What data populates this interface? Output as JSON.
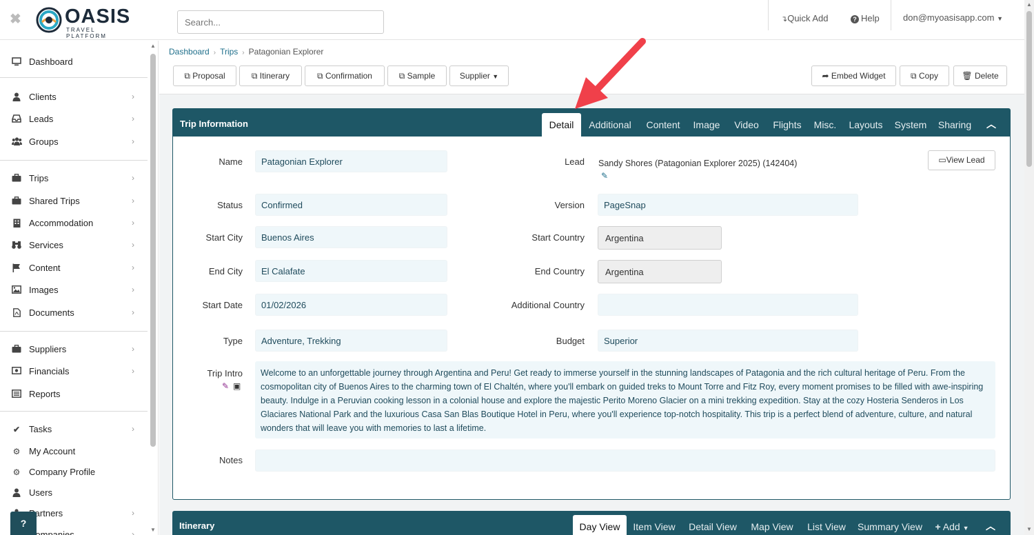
{
  "topbar": {
    "close_glyph": "✖",
    "logo_text": "OASIS",
    "logo_sub": "TRAVEL PLATFORM",
    "search_placeholder": "Search...",
    "quick_add": "Quick Add",
    "help": "Help",
    "user": "don@myoasisapp.com"
  },
  "sidebar": {
    "items": [
      {
        "label": "Dashboard",
        "icon": "monitor-icon",
        "glyph": "🖵",
        "chevron": false
      },
      {
        "label": "Clients",
        "icon": "user-icon",
        "glyph": "●",
        "chevron": true
      },
      {
        "label": "Leads",
        "icon": "inbox-icon",
        "glyph": "▭",
        "chevron": true
      },
      {
        "label": "Groups",
        "icon": "users-icon",
        "glyph": "●",
        "chevron": true
      },
      {
        "label": "Trips",
        "icon": "briefcase-icon",
        "glyph": "▆",
        "chevron": true
      },
      {
        "label": "Shared Trips",
        "icon": "briefcase-icon",
        "glyph": "▆",
        "chevron": true
      },
      {
        "label": "Accommodation",
        "icon": "building-icon",
        "glyph": "▮",
        "chevron": true
      },
      {
        "label": "Services",
        "icon": "binoculars-icon",
        "glyph": "▞",
        "chevron": true
      },
      {
        "label": "Content",
        "icon": "flag-icon",
        "glyph": "⚑",
        "chevron": true
      },
      {
        "label": "Images",
        "icon": "image-icon",
        "glyph": "▨",
        "chevron": true
      },
      {
        "label": "Documents",
        "icon": "file-pdf-icon",
        "glyph": "▯",
        "chevron": true
      },
      {
        "label": "Suppliers",
        "icon": "briefcase-icon",
        "glyph": "▆",
        "chevron": true
      },
      {
        "label": "Financials",
        "icon": "money-icon",
        "glyph": "▣",
        "chevron": true
      },
      {
        "label": "Reports",
        "icon": "list-alt-icon",
        "glyph": "▤",
        "chevron": false
      },
      {
        "label": "Tasks",
        "icon": "check-icon",
        "glyph": "✔",
        "chevron": true
      },
      {
        "label": "My Account",
        "icon": "gear-icon",
        "glyph": "⚙",
        "chevron": false
      },
      {
        "label": "Company Profile",
        "icon": "gears-icon",
        "glyph": "⚙",
        "chevron": false
      },
      {
        "label": "Users",
        "icon": "user-icon",
        "glyph": "●",
        "chevron": false
      },
      {
        "label": "Partners",
        "icon": "handshake-icon",
        "glyph": "●",
        "chevron": true
      },
      {
        "label": "Companies",
        "icon": "building-icon",
        "glyph": "▮",
        "chevron": true
      }
    ],
    "help_label": "?"
  },
  "breadcrumb": {
    "items": [
      "Dashboard",
      "Trips",
      "Patagonian Explorer"
    ]
  },
  "toolbar": {
    "proposal": "Proposal",
    "itinerary": "Itinerary",
    "confirmation": "Confirmation",
    "sample": "Sample",
    "supplier": "Supplier",
    "embed_widget": "Embed Widget",
    "copy": "Copy",
    "delete": "Delete"
  },
  "trip_panel": {
    "title": "Trip Information",
    "tabs": [
      "Detail",
      "Additional",
      "Content",
      "Image",
      "Video",
      "Flights",
      "Misc.",
      "Layouts",
      "System",
      "Sharing"
    ],
    "active_tab": "Detail",
    "view_lead": "View Lead",
    "fields": {
      "name_label": "Name",
      "name": "Patagonian Explorer",
      "lead_label": "Lead",
      "lead": "Sandy Shores (Patagonian Explorer 2025) (142404)",
      "status_label": "Status",
      "status": "Confirmed",
      "version_label": "Version",
      "version": "PageSnap",
      "start_city_label": "Start City",
      "start_city": "Buenos Aires",
      "start_country_label": "Start Country",
      "start_country": "Argentina",
      "end_city_label": "End City",
      "end_city": "El Calafate",
      "end_country_label": "End Country",
      "end_country": "Argentina",
      "start_date_label": "Start Date",
      "start_date": "01/02/2026",
      "additional_country_label": "Additional Country",
      "additional_country": "",
      "type_label": "Type",
      "type": "Adventure, Trekking",
      "budget_label": "Budget",
      "budget": "Superior",
      "trip_intro_label": "Trip Intro",
      "trip_intro": "Welcome to an unforgettable journey through Argentina and Peru! Get ready to immerse yourself in the stunning landscapes of Patagonia and the rich cultural heritage of Peru. From the cosmopolitan city of Buenos Aires to the charming town of El Chaltén, where you'll embark on guided treks to Mount Torre and Fitz Roy, every moment promises to be filled with awe-inspiring beauty. Indulge in a Peruvian cooking lesson in a colonial house and explore the majestic Perito Moreno Glacier on a mini trekking expedition. Stay at the cozy Hosteria Senderos in Los Glaciares National Park and the luxurious Casa San Blas Boutique Hotel in Peru, where you'll experience top-notch hospitality. This trip is a perfect blend of adventure, culture, and natural wonders that will leave you with memories to last a lifetime.",
      "notes_label": "Notes",
      "notes": ""
    }
  },
  "itinerary_panel": {
    "title": "Itinerary",
    "tabs": [
      "Day View",
      "Item View",
      "Detail View",
      "Map View",
      "List View",
      "Summary View"
    ],
    "active_tab": "Day View",
    "add": "Add"
  },
  "colors": {
    "panel_header": "#1e5766",
    "link": "#1f6f8b",
    "field_bg": "#eff7fa",
    "arrow": "#f0404a"
  }
}
